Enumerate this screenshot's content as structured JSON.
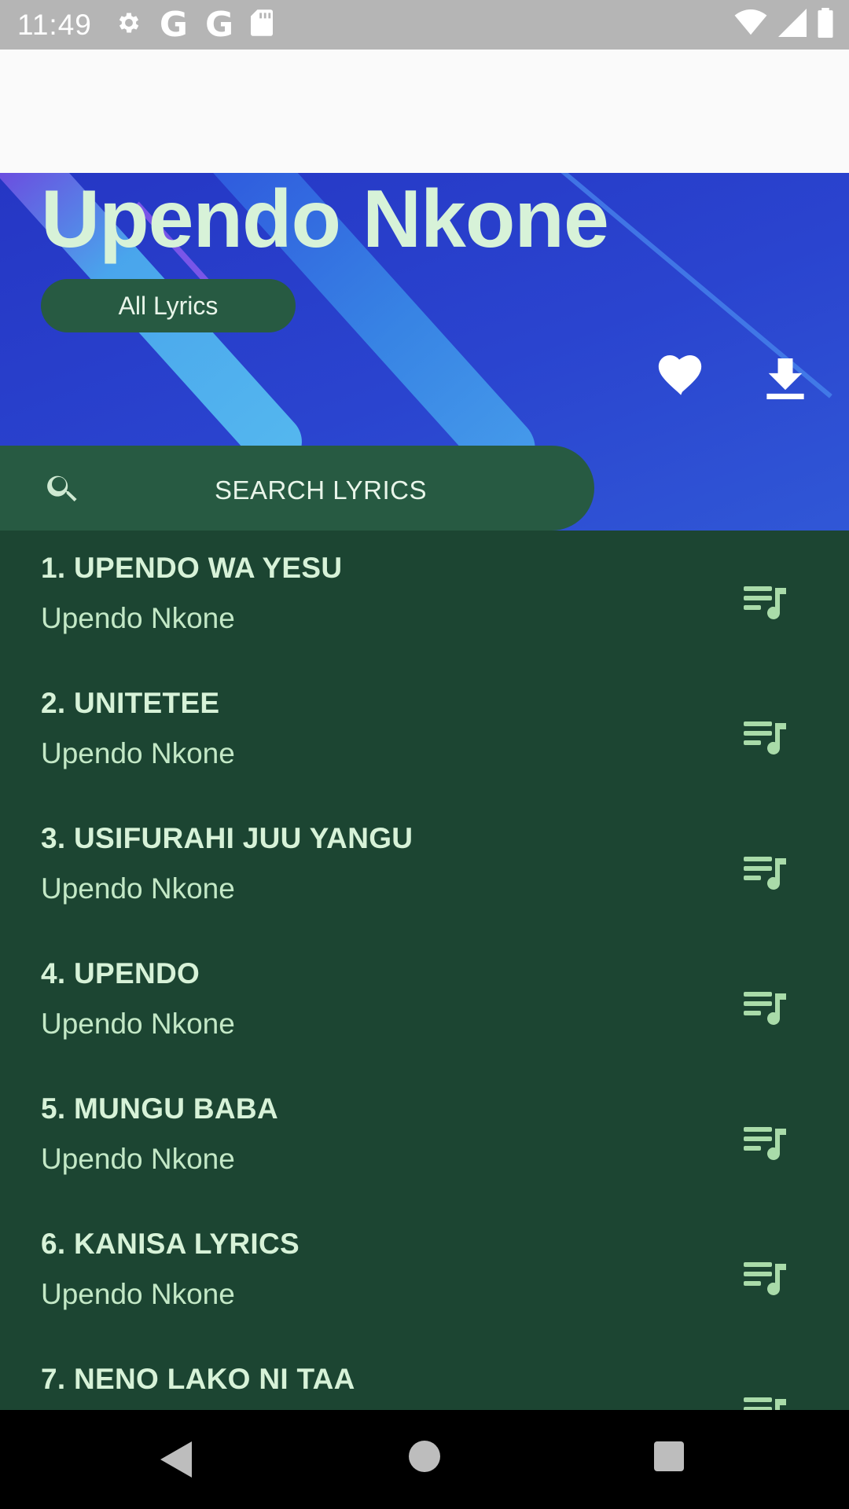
{
  "status_bar": {
    "time": "11:49",
    "left_icons": [
      "settings-icon",
      "google-icon",
      "google-icon",
      "sd-card-icon"
    ],
    "right_icons": [
      "wifi-icon",
      "signal-icon",
      "battery-icon"
    ]
  },
  "header": {
    "title": "Upendo Nkone",
    "all_lyrics_label": "All Lyrics",
    "actions": [
      "heart-icon",
      "download-icon"
    ]
  },
  "search": {
    "label": "SEARCH LYRICS"
  },
  "songs": [
    {
      "title": "1. UPENDO WA YESU",
      "artist": "Upendo Nkone"
    },
    {
      "title": "2. UNITETEE",
      "artist": "Upendo Nkone"
    },
    {
      "title": "3. USIFURAHI JUU YANGU",
      "artist": "Upendo Nkone"
    },
    {
      "title": "4. UPENDO",
      "artist": "Upendo Nkone"
    },
    {
      "title": "5. MUNGU BABA",
      "artist": "Upendo Nkone"
    },
    {
      "title": "6. KANISA LYRICS",
      "artist": "Upendo Nkone"
    },
    {
      "title": "7. NENO LAKO NI TAA",
      "artist": ""
    }
  ],
  "colors": {
    "header_blue": "#2a44cf",
    "accent_green": "#275a42",
    "list_background": "#1c4532",
    "title_text": "#d7f2d8"
  }
}
